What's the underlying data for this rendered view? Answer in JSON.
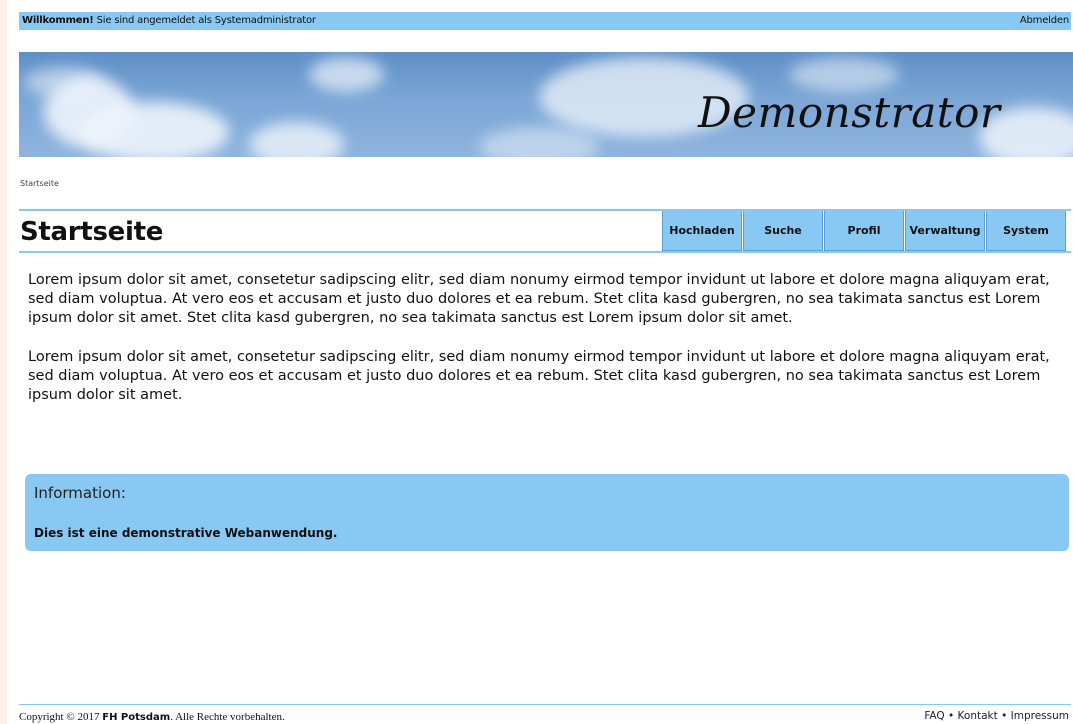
{
  "topbar": {
    "welcome_bold": "Willkommen!",
    "welcome_text": "Sie sind angemeldet als Systemadministrator",
    "logout_label": "Abmelden"
  },
  "banner": {
    "title": "Demonstrator"
  },
  "breadcrumb": "Startseite",
  "page_title": "Startseite",
  "nav": [
    {
      "label": "Hochladen"
    },
    {
      "label": "Suche"
    },
    {
      "label": "Profil"
    },
    {
      "label": "Verwaltung"
    },
    {
      "label": "System"
    }
  ],
  "content": {
    "paragraphs": [
      "Lorem ipsum dolor sit amet, consetetur sadipscing elitr, sed diam nonumy eirmod tempor invidunt ut labore et dolore magna aliquyam erat, sed diam voluptua. At vero eos et accusam et justo duo dolores et ea rebum. Stet clita kasd gubergren, no sea takimata sanctus est Lorem ipsum dolor sit amet. Stet clita kasd gubergren, no sea takimata sanctus est Lorem ipsum dolor sit amet.",
      "Lorem ipsum dolor sit amet, consetetur sadipscing elitr, sed diam nonumy eirmod tempor invidunt ut labore et dolore magna aliquyam erat, sed diam voluptua. At vero eos et accusam et justo duo dolores et ea rebum. Stet clita kasd gubergren, no sea takimata sanctus est Lorem ipsum dolor sit amet."
    ]
  },
  "info": {
    "title": "Information:",
    "text": "Dies ist eine demonstrative Webanwendung."
  },
  "footer": {
    "copyright_prefix": "Copyright © 2017",
    "copyright_org": "FH Potsdam",
    "copyright_suffix": ". Alle Rechte vorbehalten.",
    "links": [
      "FAQ",
      "Kontakt",
      "Impressum"
    ],
    "separator": " • "
  },
  "colors": {
    "accent": "#88c8f3",
    "nav_border": "#5b9ed3",
    "side_bar": "#fdf1ea"
  }
}
